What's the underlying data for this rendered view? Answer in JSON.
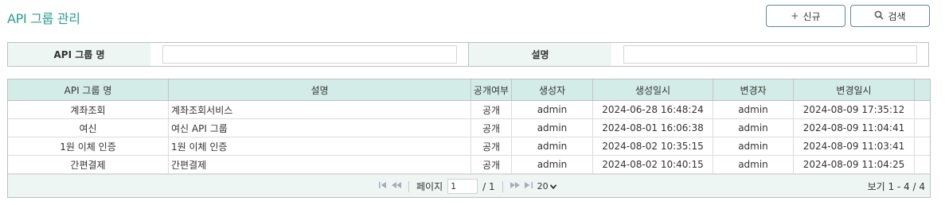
{
  "page": {
    "title": "API 그룹 관리"
  },
  "toolbar": {
    "new_icon": "+",
    "new_label": "신규",
    "search_icon": "⚲",
    "search_label": "검색"
  },
  "search_form": {
    "group_name_label": "API 그룹 명",
    "group_name_value": "",
    "description_label": "설명",
    "description_value": ""
  },
  "grid": {
    "columns": [
      "API 그룹 명",
      "설명",
      "공개여부",
      "생성자",
      "생성일시",
      "변경자",
      "변경일시"
    ],
    "rows": [
      [
        "계좌조회",
        "계좌조회서비스",
        "공개",
        "admin",
        "2024-06-28 16:48:24",
        "admin",
        "2024-08-09 17:35:12"
      ],
      [
        "여신",
        "여신 API 그룹",
        "공개",
        "admin",
        "2024-08-01 16:06:38",
        "admin",
        "2024-08-09 11:04:41"
      ],
      [
        "1원 이체 인증",
        "1원 이체 인증",
        "공개",
        "admin",
        "2024-08-02 10:35:15",
        "admin",
        "2024-08-09 11:03:41"
      ],
      [
        "간편결제",
        "간편결제",
        "공개",
        "admin",
        "2024-08-02 10:40:15",
        "admin",
        "2024-08-09 11:04:25"
      ]
    ]
  },
  "pager": {
    "first_icon": "first-page-icon",
    "prev_icon": "prev-page-icon",
    "next_icon": "next-page-icon",
    "last_icon": "last-page-icon",
    "page_label": "페이지",
    "page_value": "1",
    "page_total": "/ 1",
    "page_size": "20",
    "info": "보기 1 - 4 / 4"
  }
}
